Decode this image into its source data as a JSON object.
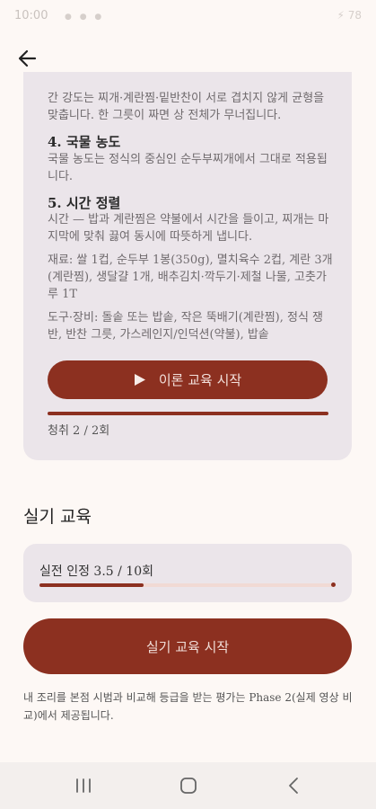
{
  "status": {
    "time": "10:00",
    "right": "⚡ 78"
  },
  "theory": {
    "intro_text": "간 강도는 찌개·계란찜·밑반찬이 서로 겹치지 않게 균형을 맞춥니다. 한 그릇이 짜면 상 전체가 무너집니다.",
    "h4": "4. 국물 농도",
    "p4": "국물 농도는 정식의 중심인 순두부찌개에서 그대로 적용됩니다.",
    "h5": "5. 시간 정렬",
    "p5": "시간 — 밥과 계란찜은 약불에서 시간을 들이고, 찌개는 마지막에 맞춰 끓여 동시에 따뜻하게 냅니다.",
    "ingredients": "재료: 쌀 1컵, 순두부 1봉(350g), 멸치육수 2컵, 계란 3개(계란찜), 생달걀 1개, 배추김치·깍두기·제철 나물, 고춧가루 1T",
    "tools": "도구·장비: 돌솥 또는 밥솥, 작은 뚝배기(계란찜), 정식 쟁반, 반찬 그릇, 가스레인지/인덕션(약불), 밥솥",
    "start_label": "이론 교육 시작",
    "listen_text": "청취 2 / 2회",
    "listen_progress": 1.0
  },
  "practice": {
    "section_title": "실기 교육",
    "progress_label": "실전 인정 3.5 / 10회",
    "progress": 0.35,
    "start_label": "실기 교육 시작",
    "footnote": "내 조리를 본점 시범과 비교해 등급을 받는 평가는 Phase 2(실제 영상 비교)에서 제공됩니다."
  },
  "icons": {
    "back": "arrow-left-icon",
    "play": "play-icon",
    "nav_recent": "recent-apps-icon",
    "nav_home": "home-icon",
    "nav_back": "chevron-left-icon"
  },
  "colors": {
    "accent": "#8c3020",
    "card": "#ebe5ea",
    "background": "#fdf8f5"
  }
}
